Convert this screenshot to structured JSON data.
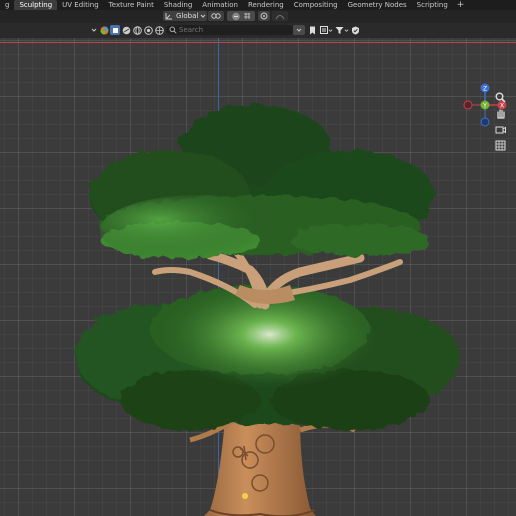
{
  "workspace_tabs": [
    {
      "label": "g"
    },
    {
      "label": "Sculpting"
    },
    {
      "label": "UV Editing"
    },
    {
      "label": "Texture Paint"
    },
    {
      "label": "Shading"
    },
    {
      "label": "Animation"
    },
    {
      "label": "Rendering"
    },
    {
      "label": "Compositing"
    },
    {
      "label": "Geometry Nodes"
    },
    {
      "label": "Scripting"
    }
  ],
  "active_tab": "Sculpting",
  "add_tab_label": "+",
  "header": {
    "orientation_value": "Global",
    "search_placeholder": "Search"
  },
  "gizmo": {
    "x_label": "X",
    "y_label": "Y",
    "z_label": "Z"
  },
  "colors": {
    "x_axis": "#c8414b",
    "y_axis": "#73b32f",
    "z_axis": "#3c6fd1"
  }
}
